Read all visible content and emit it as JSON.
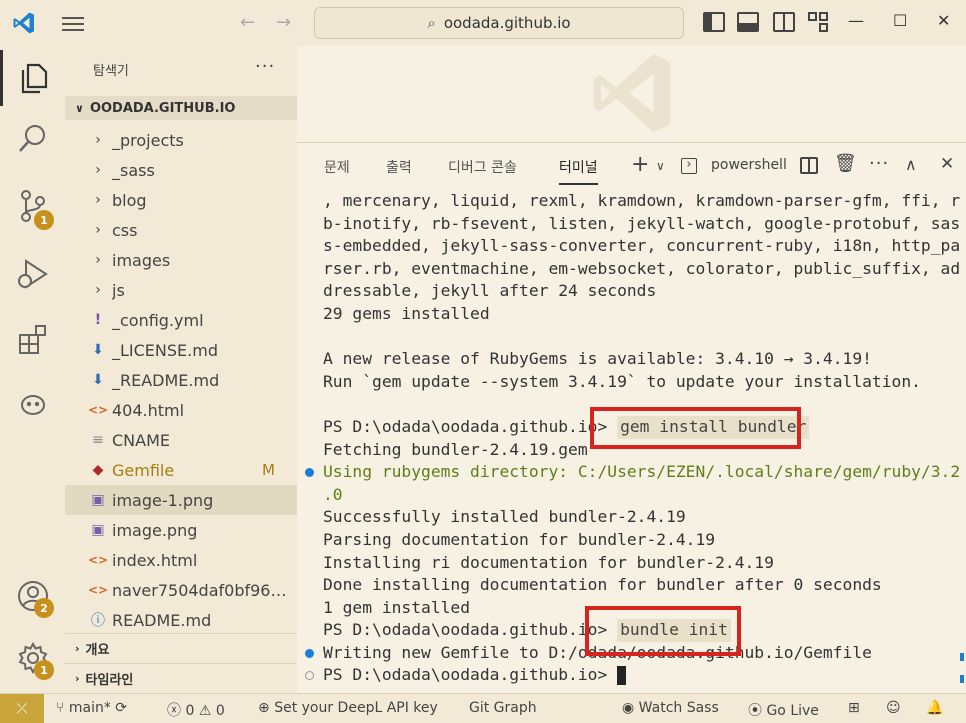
{
  "titlebar": {
    "search_text": "oodada.github.io"
  },
  "activity": {
    "source_control_badge": "1",
    "accounts_badge": "2",
    "settings_badge": "1"
  },
  "sidebar": {
    "title": "탐색기",
    "more": "···",
    "section_title": "OODADA.GITHUB.IO",
    "items": [
      {
        "label": "_projects",
        "icon": "›",
        "type": "folder"
      },
      {
        "label": "_sass",
        "icon": "›",
        "type": "folder"
      },
      {
        "label": "blog",
        "icon": "›",
        "type": "folder"
      },
      {
        "label": "css",
        "icon": "›",
        "type": "folder"
      },
      {
        "label": "images",
        "icon": "›",
        "type": "folder"
      },
      {
        "label": "js",
        "icon": "›",
        "type": "folder"
      },
      {
        "label": "_config.yml",
        "icon": "!",
        "type": "yaml"
      },
      {
        "label": "_LICENSE.md",
        "icon": "⬇",
        "type": "markdown"
      },
      {
        "label": "_README.md",
        "icon": "⬇",
        "type": "markdown"
      },
      {
        "label": "404.html",
        "icon": "<>",
        "type": "html"
      },
      {
        "label": "CNAME",
        "icon": "≡",
        "type": "text"
      },
      {
        "label": "Gemfile",
        "icon": "◆",
        "type": "ruby",
        "status": "M"
      },
      {
        "label": "image-1.png",
        "icon": "▣",
        "type": "image"
      },
      {
        "label": "image.png",
        "icon": "▣",
        "type": "image"
      },
      {
        "label": "index.html",
        "icon": "<>",
        "type": "html"
      },
      {
        "label": "naver7504daf0bf96a9...",
        "icon": "<>",
        "type": "html"
      },
      {
        "label": "README.md",
        "icon": "ⓘ",
        "type": "info"
      }
    ],
    "outline_title": "개요",
    "timeline_title": "타임라인"
  },
  "panel": {
    "tabs": [
      "문제",
      "출력",
      "디버그 콘솔",
      "터미널"
    ],
    "active_tab": "터미널",
    "add_label": "+",
    "shell_label": "powershell",
    "terminal_lines": [
      {
        "text": ", mercenary, liquid, rexml, kramdown, kramdown-parser-gfm, ffi, r"
      },
      {
        "text": "b-inotify, rb-fsevent, listen, jekyll-watch, google-protobuf, sas"
      },
      {
        "text": "s-embedded, jekyll-sass-converter, concurrent-ruby, i18n, http_pa"
      },
      {
        "text": "rser.rb, eventmachine, em-websocket, colorator, public_suffix, ad"
      },
      {
        "text": "dressable, jekyll after 24 seconds"
      },
      {
        "text": "29 gems installed"
      },
      {
        "text": ""
      },
      {
        "text": "A new release of RubyGems is available: 3.4.10 → 3.4.19!"
      },
      {
        "text": "Run `gem update --system 3.4.19` to update your installation."
      },
      {
        "text": ""
      },
      {
        "prompt": "PS D:\\odada\\oodada.github.io> ",
        "cmd": "gem install bundler"
      },
      {
        "text": "Fetching bundler-2.4.19.gem"
      },
      {
        "text": "Using rubygems directory: C:/Users/EZEN/.local/share/gem/ruby/3.2",
        "style": "olive",
        "dot": "blue"
      },
      {
        "text": ".0",
        "style": "olive"
      },
      {
        "text": "Successfully installed bundler-2.4.19"
      },
      {
        "text": "Parsing documentation for bundler-2.4.19"
      },
      {
        "text": "Installing ri documentation for bundler-2.4.19"
      },
      {
        "text": "Done installing documentation for bundler after 0 seconds"
      },
      {
        "text": "1 gem installed"
      },
      {
        "prompt": "PS D:\\odada\\oodada.github.io> ",
        "cmd": "bundle init"
      },
      {
        "text": "Writing new Gemfile to D:/odada/oodada.github.io/Gemfile",
        "dot": "blue"
      },
      {
        "prompt": "PS D:\\odada\\oodada.github.io> ",
        "cmd": "",
        "dot": "hollow",
        "cursor": true
      }
    ]
  },
  "statusbar": {
    "branch": "main*",
    "errors": "0",
    "warnings": "0",
    "deepl": "Set your DeepL API key",
    "git_graph": "Git Graph",
    "watch_sass": "Watch Sass",
    "go_live": "Go Live"
  },
  "colors": {
    "accent_red": "#d8231f",
    "badge": "#c7901c",
    "remote": "#c9a43a",
    "vscode_blue": "#1f7fd1"
  }
}
